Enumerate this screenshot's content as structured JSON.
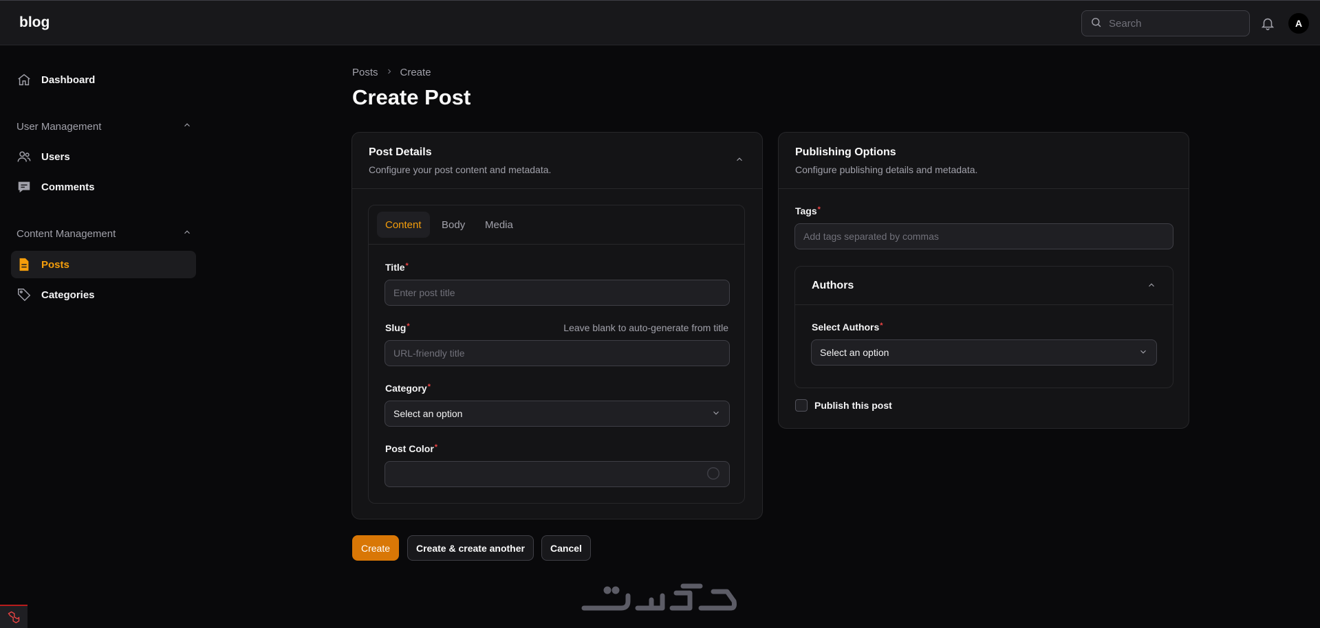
{
  "header": {
    "brand": "blog",
    "search_placeholder": "Search",
    "avatar_initial": "A"
  },
  "sidebar": {
    "dashboard": "Dashboard",
    "groups": [
      {
        "label": "User Management",
        "items": [
          "Users",
          "Comments"
        ]
      },
      {
        "label": "Content Management",
        "items": [
          "Posts",
          "Categories"
        ]
      }
    ],
    "active_item": "Posts"
  },
  "breadcrumb": [
    "Posts",
    "Create"
  ],
  "page_title": "Create Post",
  "post_details": {
    "title": "Post Details",
    "subtitle": "Configure your post content and metadata.",
    "tabs": [
      "Content",
      "Body",
      "Media"
    ],
    "active_tab": "Content",
    "fields": {
      "title_label": "Title",
      "title_placeholder": "Enter post title",
      "slug_label": "Slug",
      "slug_hint": "Leave blank to auto-generate from title",
      "slug_placeholder": "URL-friendly title",
      "category_label": "Category",
      "category_value": "Select an option",
      "color_label": "Post Color",
      "required_mark": "*"
    }
  },
  "publishing": {
    "title": "Publishing Options",
    "subtitle": "Configure publishing details and metadata.",
    "tags_label": "Tags",
    "tags_placeholder": "Add tags separated by commas",
    "authors_section": "Authors",
    "authors_label": "Select Authors",
    "authors_value": "Select an option",
    "publish_label": "Publish this post"
  },
  "actions": {
    "create": "Create",
    "create_another": "Create & create another",
    "cancel": "Cancel"
  },
  "colors": {
    "accent": "#f59e0b",
    "primary_button": "#d97706",
    "required": "#ef4444"
  }
}
